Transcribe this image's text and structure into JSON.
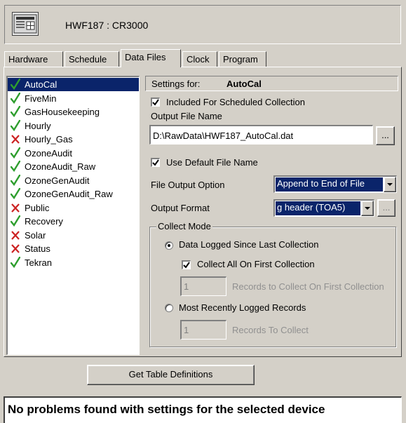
{
  "header": {
    "device_title": "HWF187 : CR3000"
  },
  "tabs": [
    {
      "label": "Hardware"
    },
    {
      "label": "Schedule"
    },
    {
      "label": "Data Files"
    },
    {
      "label": "Clock"
    },
    {
      "label": "Program"
    }
  ],
  "active_tab": "Data Files",
  "tables": [
    {
      "label": "AutoCal",
      "status": "ok"
    },
    {
      "label": "FiveMin",
      "status": "ok"
    },
    {
      "label": "GasHousekeeping",
      "status": "ok"
    },
    {
      "label": "Hourly",
      "status": "ok"
    },
    {
      "label": "Hourly_Gas",
      "status": "off"
    },
    {
      "label": "OzoneAudit",
      "status": "ok"
    },
    {
      "label": "OzoneAudit_Raw",
      "status": "ok"
    },
    {
      "label": "OzoneGenAudit",
      "status": "ok"
    },
    {
      "label": "OzoneGenAudit_Raw",
      "status": "ok"
    },
    {
      "label": "Public",
      "status": "off"
    },
    {
      "label": "Recovery",
      "status": "ok"
    },
    {
      "label": "Solar",
      "status": "off"
    },
    {
      "label": "Status",
      "status": "off"
    },
    {
      "label": "Tekran",
      "status": "ok"
    }
  ],
  "settings": {
    "for_label": "Settings for:",
    "for_value": "AutoCal",
    "included_label": "Included For Scheduled Collection",
    "output_file_label": "Output File Name",
    "output_file_value": "D:\\RawData\\HWF187_AutoCal.dat",
    "browse_label": "...",
    "use_default_label": "Use Default File Name",
    "file_output_option_label": "File Output Option",
    "file_output_option_value": "Append to End of File",
    "output_format_label": "Output Format",
    "output_format_value": "g header (TOA5)",
    "format_opts_label": "...",
    "collect_mode_label": "Collect Mode",
    "since_last_label": "Data Logged Since Last Collection",
    "collect_all_label": "Collect All On First Collection",
    "first_records_value": "1",
    "first_records_label": "Records to Collect On First Collection",
    "most_recent_label": "Most Recently Logged Records",
    "recent_records_value": "1",
    "recent_records_label": "Records To Collect"
  },
  "footer": {
    "get_table_button": "Get Table Definitions",
    "status_message": "No problems found with settings for the selected device"
  },
  "colors": {
    "selection": "#0a246a",
    "check": "#2e9e2e",
    "cross": "#cc2222"
  }
}
